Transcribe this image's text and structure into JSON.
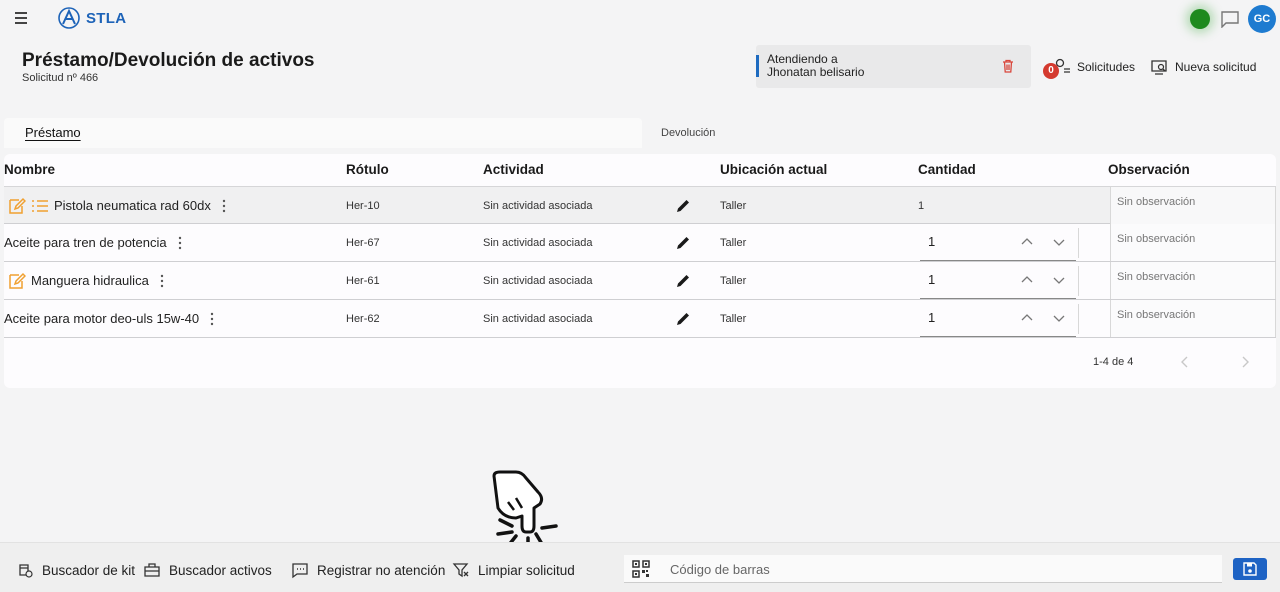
{
  "app": {
    "name": "STLA",
    "avatar_initials": "GC",
    "status_color": "#1e8a1e"
  },
  "header": {
    "title": "Préstamo/Devolución de activos",
    "request_number": "Solicitud nº 466",
    "attending_label": "Atendiendo a",
    "attending_name": "Jhonatan belisario",
    "requests_badge": "0",
    "requests_label": "Solicitudes",
    "new_request_label": "Nueva solicitud"
  },
  "tabs": [
    {
      "label": "Préstamo",
      "active": true
    },
    {
      "label": "Devolución",
      "active": false
    }
  ],
  "table": {
    "columns": [
      "Nombre",
      "Rótulo",
      "Actividad",
      "Ubicación actual",
      "Cantidad",
      "Observación"
    ],
    "rows": [
      {
        "name": "Pistola neumatica rad 60dx",
        "label": "Her-10",
        "activity": "Sin actividad asociada",
        "location": "Taller",
        "quantity": "1",
        "observation_placeholder": "Sin observación",
        "icons": [
          "edit-note-icon",
          "list-icon"
        ]
      },
      {
        "name": "Aceite para tren de potencia",
        "label": "Her-67",
        "activity": "Sin actividad asociada",
        "location": "Taller",
        "quantity": "1",
        "observation_placeholder": "Sin observación",
        "icons": []
      },
      {
        "name": "Manguera hidraulica",
        "label": "Her-61",
        "activity": "Sin actividad asociada",
        "location": "Taller",
        "quantity": "1",
        "observation_placeholder": "Sin observación",
        "icons": [
          "edit-note-icon"
        ]
      },
      {
        "name": "Aceite para motor deo-uls 15w-40",
        "label": "Her-62",
        "activity": "Sin actividad asociada",
        "location": "Taller",
        "quantity": "1",
        "observation_placeholder": "Sin observación",
        "icons": []
      }
    ],
    "pagination": "1-4 de 4"
  },
  "bottom_bar": {
    "kit_search": "Buscador de kit",
    "asset_search": "Buscador activos",
    "register_no_attention": "Registrar no atención",
    "clear_request": "Limpiar solicitud",
    "barcode_placeholder": "Código de barras"
  },
  "colors": {
    "accent": "#1e63c4",
    "edit_icon": "#f0a030",
    "badge": "#d43a2f"
  }
}
